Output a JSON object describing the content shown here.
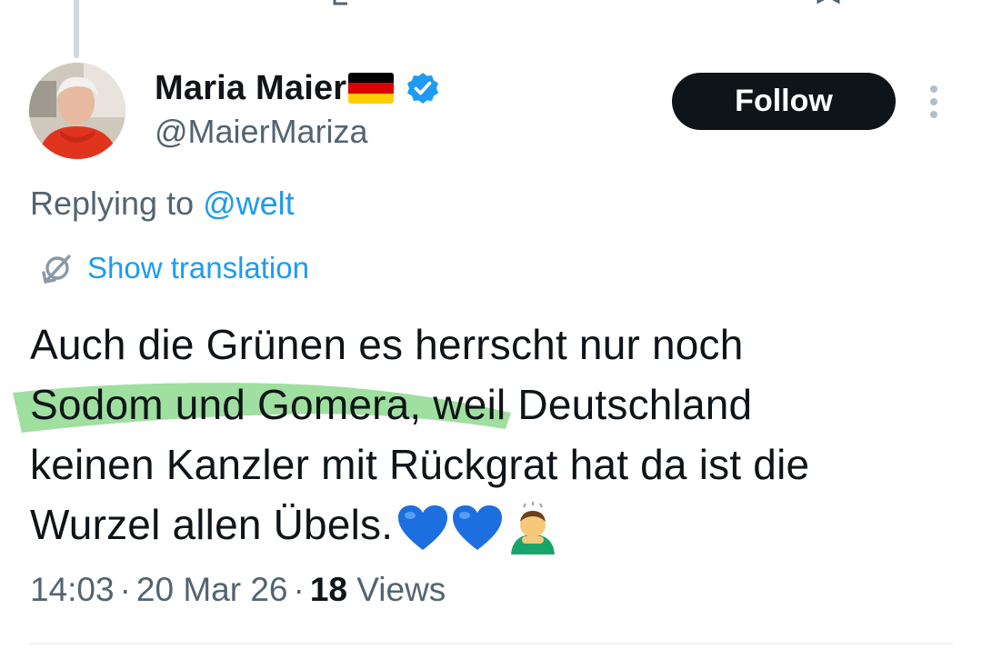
{
  "tweet": {
    "author": {
      "display_name": "Maria Maier",
      "flag_icon": "germany-flag",
      "verified_icon": "verified-badge-icon",
      "handle": "@MaierMariza"
    },
    "follow_label": "Follow",
    "replying_prefix": "Replying to ",
    "replying_handle": "@welt",
    "show_translation_label": "Show translation",
    "text_lines": [
      "Auch die Grünen es herrscht nur noch",
      "Sodom und Gomera, weil Deutschland",
      "keinen Kanzler mit Rückgrat hat da ist die",
      "Wurzel allen Übels."
    ],
    "emojis": [
      "blue-heart",
      "blue-heart",
      "man-bowing"
    ],
    "time": "14:03",
    "date": "20 Mar 26",
    "views_count": "18",
    "views_label": " Views"
  },
  "colors": {
    "text": "#0f1419",
    "secondary": "#536471",
    "link": "#1d9bf0",
    "highlight": "#7fd47f",
    "follow_bg": "#0f1419"
  }
}
